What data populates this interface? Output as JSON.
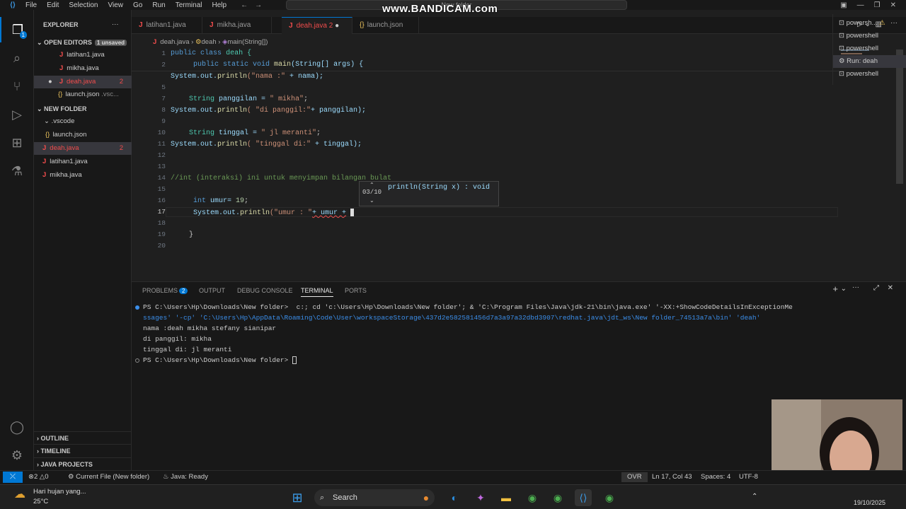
{
  "titlebar": {
    "menu": [
      "File",
      "Edit",
      "Selection",
      "View",
      "Go",
      "Run",
      "Terminal",
      "Help"
    ],
    "command_center": "New folder",
    "watermark": "www.BANDICAM.com"
  },
  "explorer": {
    "header": "EXPLORER",
    "open_editors": "OPEN EDITORS",
    "unsaved": "1 unsaved",
    "open_files": [
      {
        "name": "latihan1.java",
        "count": ""
      },
      {
        "name": "mikha.java",
        "count": ""
      },
      {
        "name": "deah.java",
        "count": "2"
      },
      {
        "name": "launch.json",
        "count": ".vsc..."
      }
    ],
    "folder": "NEW FOLDER",
    "vscode": ".vscode",
    "launch": "launch.json",
    "files": [
      {
        "name": "deah.java",
        "count": "2"
      },
      {
        "name": "latihan1.java",
        "count": ""
      },
      {
        "name": "mikha.java",
        "count": ""
      }
    ],
    "outline": "OUTLINE",
    "timeline": "TIMELINE",
    "java_projects": "JAVA PROJECTS"
  },
  "tabs": [
    {
      "label": "latihan1.java"
    },
    {
      "label": "mikha.java"
    },
    {
      "label": "deah.java 2"
    },
    {
      "label": "launch.json"
    }
  ],
  "breadcrumb": {
    "file": "deah.java",
    "cls": "deah",
    "method": "main(String[])"
  },
  "code": {
    "l1": "1",
    "l2": "2",
    "l5": "5",
    "l7": "7",
    "l8": "8",
    "l9": "9",
    "l10": "10",
    "l11": "11",
    "l12": "12",
    "l13": "13",
    "l14": "14",
    "l15": "15",
    "l16": "16",
    "l17": "17",
    "l18": "18",
    "l19": "19",
    "l20": "20",
    "public": "public",
    "class": "class",
    "deah": "deah {",
    "static": "public static void",
    "main": "main",
    "string_args": "(String[] args) {",
    "sys1": "System.out.",
    "println": "println",
    "str1": "(\"nama :\"",
    "plus_nama": " + nama);",
    "string_kw": "String",
    "panggilan_decl": " panggilan = ",
    "str_mikha": "\" mikha\"",
    "semi": ";",
    "str2": "( \"di panggil:\"",
    "plus_panggilan": "+ panggilan);",
    "tinggal_decl": " tinggal = ",
    "str_jl": "\" jl meranti\"",
    "str3": "( \"tinggal di:\"",
    "plus_tinggal": " + tinggal);",
    "comment": "//int (interaksi) ini untuk menyimpan bilangan bulat",
    "int_kw": "int",
    "umur_decl": " umur= ",
    "nineteen": "19",
    "str4": "(\"umur : \"",
    "plus_umur": "+ umur +",
    "brace": "}"
  },
  "hint": {
    "counter": "03/10",
    "signature": "println(String x) : void"
  },
  "panel": {
    "problems": "PROBLEMS",
    "problems_count": "2",
    "output": "OUTPUT",
    "debug": "DEBUG CONSOLE",
    "terminal": "TERMINAL",
    "ports": "PORTS"
  },
  "terminal": {
    "line1a": "PS C:\\Users\\Hp\\Downloads\\New folder>  c:; cd 'c:\\Users\\Hp\\Downloads\\New folder'; & 'C:\\Program Files\\Java\\jdk-21\\bin\\java.exe' '-XX:+ShowCodeDetailsInExceptionMe",
    "line1b": "ssages' '-cp' 'C:\\Users\\Hp\\AppData\\Roaming\\Code\\User\\workspaceStorage\\437d2e582581456d7a3a97a32dbd3907\\redhat.java\\jdt_ws\\New folder_74513a7a\\bin' 'deah'",
    "out1": "nama :deah mikha stefany sianipar",
    "out2": "di panggil: mikha",
    "out3": "tinggal di: jl meranti",
    "prompt": "PS C:\\Users\\Hp\\Downloads\\New folder> "
  },
  "terminals": [
    "powersh...",
    "powershell",
    "powershell",
    "Run: deah",
    "powershell"
  ],
  "status": {
    "errors": "2",
    "warnings": "0",
    "current_file": "Current File (New folder)",
    "java": "Java: Ready",
    "ovr": "OVR",
    "position": "Ln 17, Col 43",
    "spaces": "Spaces: 4",
    "encoding": "UTF-8"
  },
  "taskbar": {
    "weather_text": "Hari hujan yang...",
    "temp": "25°C",
    "search": "Search",
    "date": "19/10/2025"
  }
}
